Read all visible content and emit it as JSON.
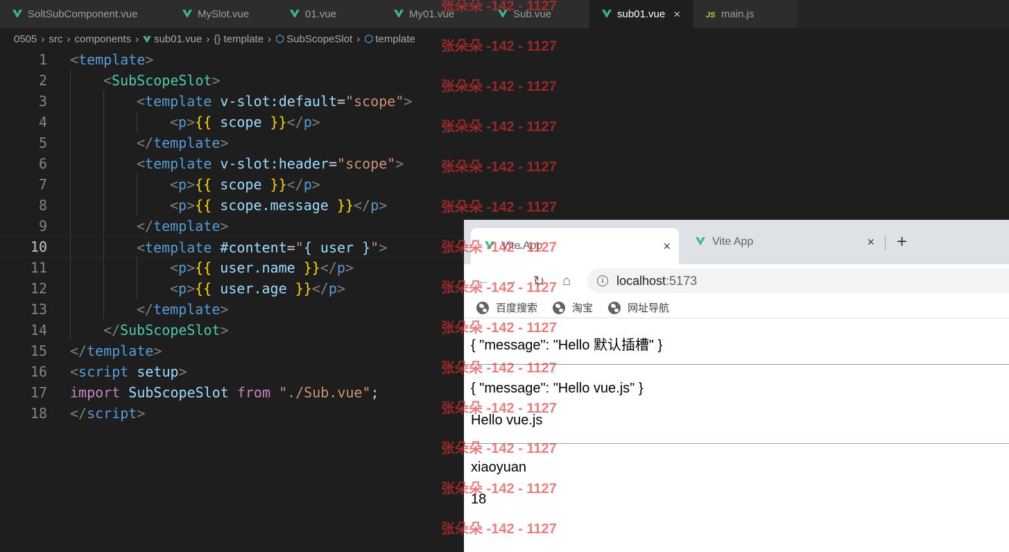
{
  "editor": {
    "tabs": [
      {
        "label": "SoltSubComponent.vue",
        "icon": "vue-icon"
      },
      {
        "label": "MySlot.vue",
        "icon": "vue-icon"
      },
      {
        "label": "01.vue",
        "icon": "vue-icon"
      },
      {
        "label": "My01.vue",
        "icon": "vue-icon"
      },
      {
        "label": "Sub.vue",
        "icon": "vue-icon"
      },
      {
        "label": "sub01.vue",
        "icon": "vue-icon",
        "active": true,
        "close": "×"
      },
      {
        "label": "main.js",
        "icon": "js-icon",
        "icon_text": "JS"
      }
    ],
    "breadcrumb": {
      "items": [
        "0505",
        "src",
        "components",
        "sub01.vue",
        "{} template",
        "SubScopeSlot",
        "template"
      ]
    },
    "line_numbers": [
      "1",
      "2",
      "3",
      "4",
      "5",
      "6",
      "7",
      "8",
      "9",
      "10",
      "11",
      "12",
      "13",
      "14",
      "15",
      "16",
      "17",
      "18"
    ],
    "current_line": "10",
    "code": {
      "l1": [
        "<",
        "template",
        ">"
      ],
      "l2": [
        "<",
        "SubScopeSlot",
        ">"
      ],
      "l3": [
        "<",
        "template",
        " ",
        "v-slot:default",
        "=",
        "\"",
        "scope",
        "\"",
        ">"
      ],
      "l4": [
        "<",
        "p",
        ">",
        "{{",
        " ",
        "scope",
        " ",
        "}}",
        "</",
        "p",
        ">"
      ],
      "l5": [
        "</",
        "template",
        ">"
      ],
      "l6": [
        "<",
        "template",
        " ",
        "v-slot:header",
        "=",
        "\"",
        "scope",
        "\"",
        ">"
      ],
      "l7": [
        "<",
        "p",
        ">",
        "{{",
        " ",
        "scope",
        " ",
        "}}",
        "</",
        "p",
        ">"
      ],
      "l8": [
        "<",
        "p",
        ">",
        "{{",
        " ",
        "scope.message",
        " ",
        "}}",
        "</",
        "p",
        ">"
      ],
      "l9": [
        "</",
        "template",
        ">"
      ],
      "l10": [
        "<",
        "template",
        " ",
        "#content",
        "=",
        "\"",
        "{ user }",
        "\"",
        ">"
      ],
      "l11": [
        "<",
        "p",
        ">",
        "{{",
        " ",
        "user.name",
        " ",
        "}}",
        "</",
        "p",
        ">"
      ],
      "l12": [
        "<",
        "p",
        ">",
        "{{",
        " ",
        "user.age",
        " ",
        "}}",
        "</",
        "p",
        ">"
      ],
      "l13": [
        "</",
        "template",
        ">"
      ],
      "l14": [
        "</",
        "SubScopeSlot",
        ">"
      ],
      "l15": [
        "</",
        "template",
        ">"
      ],
      "l16": [
        "<",
        "script",
        " ",
        "setup",
        ">"
      ],
      "l17": [
        "import",
        " ",
        "SubScopeSlot",
        " ",
        "from",
        " ",
        "\"./Sub.vue\"",
        ";"
      ],
      "l18": [
        "</",
        "script",
        ">"
      ]
    }
  },
  "watermark": {
    "text": "张朵朵 -142 - 1127",
    "color": "#de3030"
  },
  "browser": {
    "tabs": [
      {
        "label": "Vite App",
        "close": "×",
        "active": true
      },
      {
        "label": "Vite App",
        "close": "×"
      }
    ],
    "new_tab": "+",
    "nav": {
      "back": "←",
      "forward": "→",
      "reload": "↻",
      "home": "⌂"
    },
    "address": {
      "info_icon": "i",
      "host": "localhost",
      "port": ":5173"
    },
    "bookmarks": [
      "百度搜索",
      "淘宝",
      "网址导航"
    ],
    "page": {
      "lines": [
        "{ \"message\": \"Hello 默认插槽\" }",
        "{ \"message\": \"Hello vue.js\" }",
        "Hello vue.js",
        "xiaoyuan",
        "18"
      ]
    }
  },
  "colors": {
    "editor_bg": "#1e1e1e",
    "tag": "#569cd6",
    "component": "#4ec9b0",
    "attribute": "#9cdcfe",
    "string": "#ce9178",
    "brace": "#ffd700",
    "keyword": "#c586c0",
    "vue_green": "#41b883"
  }
}
